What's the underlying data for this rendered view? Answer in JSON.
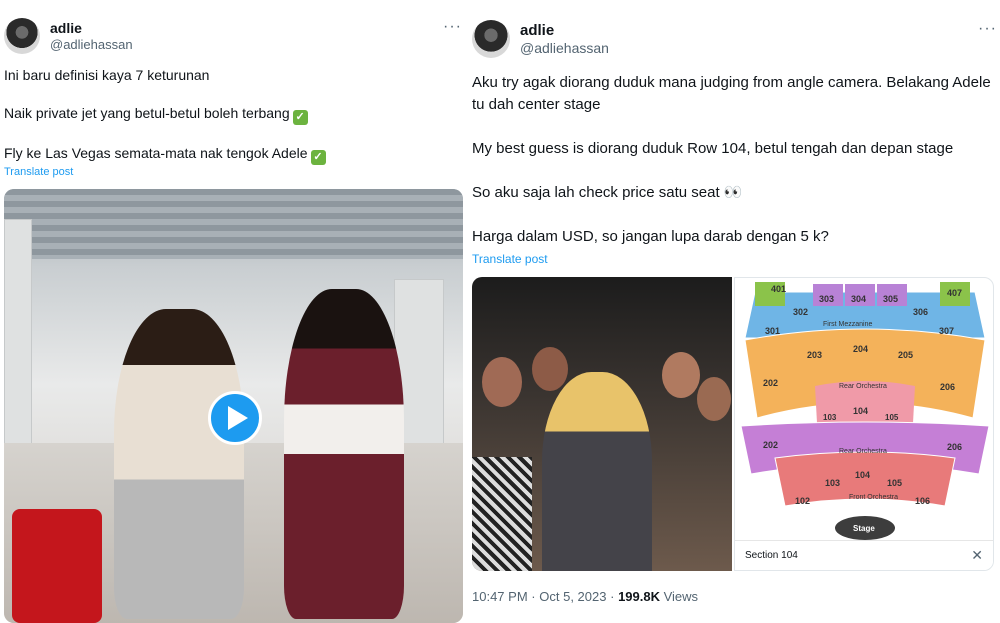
{
  "left_tweet": {
    "author": {
      "display_name": "adlie",
      "handle": "@adliehassan"
    },
    "more_icon": "ellipsis-icon",
    "lines": [
      "Ini baru definisi kaya 7 keturunan",
      "Naik private jet yang betul-betul boleh terbang",
      "Fly ke Las Vegas semata-mata nak tengok Adele"
    ],
    "check_icon": "check-mark-emoji",
    "translate_label": "Translate post",
    "play_icon": "play-icon"
  },
  "right_tweet": {
    "author": {
      "display_name": "adlie",
      "handle": "@adliehassan"
    },
    "more_icon": "ellipsis-icon",
    "paragraphs": [
      "Aku try agak diorang duduk mana judging from angle camera. Belakang Adele tu dah center stage",
      "My best guess is diorang duduk Row 104, betul tengah dan depan stage",
      "So aku saja lah check price satu seat 👀",
      "Harga dalam USD, so jangan lupa darab dengan 5 k?"
    ],
    "translate_label": "Translate post",
    "seat_map": {
      "upper_labels": [
        "401",
        "302",
        "303",
        "304",
        "305",
        "306",
        "407",
        "301",
        "307",
        "202",
        "203",
        "204",
        "205",
        "206",
        "103",
        "104",
        "105"
      ],
      "first_mezzanine": "First Mezzanine",
      "rear_orchestra_top": "Rear Orchestra",
      "lower_labels": [
        "202",
        "206",
        "103",
        "104",
        "105",
        "102",
        "106"
      ],
      "rear_orchestra": "Rear Orchestra",
      "front_orchestra": "Front Orchestra",
      "stage": "Stage",
      "section_label": "Section 104",
      "close_icon": "close-icon"
    },
    "time": "10:47 PM",
    "sep": "·",
    "date": "Oct 5, 2023",
    "views_count": "199.8K",
    "views_label": "Views"
  }
}
